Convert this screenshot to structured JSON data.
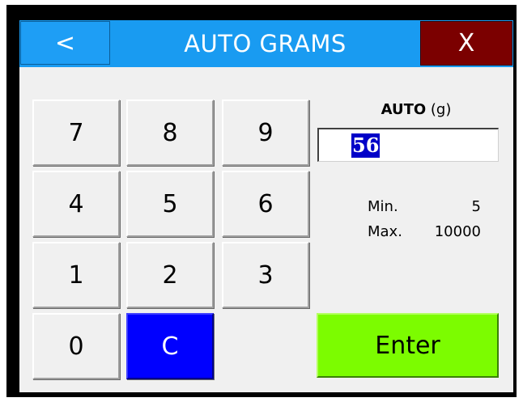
{
  "header": {
    "back_label": "<",
    "title": "AUTO GRAMS",
    "close_label": "X"
  },
  "keypad": {
    "k7": "7",
    "k8": "8",
    "k9": "9",
    "k4": "4",
    "k5": "5",
    "k6": "6",
    "k1": "1",
    "k2": "2",
    "k3": "3",
    "k0": "0",
    "clear": "C"
  },
  "entry": {
    "label_bold": "AUTO",
    "label_unit": "(g)",
    "value": "56",
    "min_label": "Min.",
    "min_value": "5",
    "max_label": "Max.",
    "max_value": "10000"
  },
  "actions": {
    "enter_label": "Enter"
  },
  "colors": {
    "titlebar": "#199bf1",
    "close": "#7b0000",
    "clear_key": "#0000ff",
    "enter": "#7cfc00"
  }
}
